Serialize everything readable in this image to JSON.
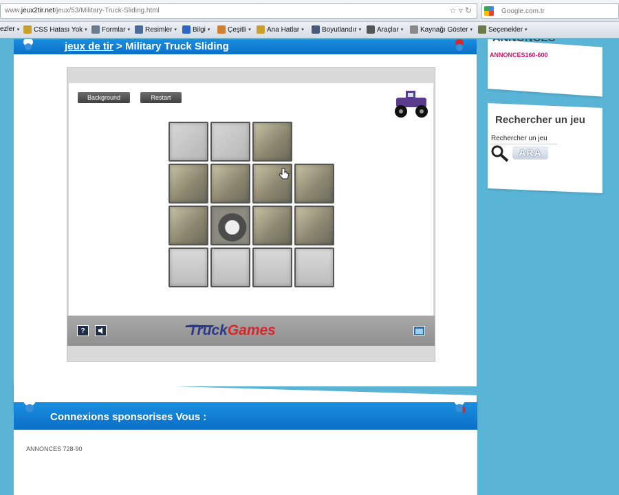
{
  "browser": {
    "url_prefix": "www.",
    "url_host": "jeux2tir.net",
    "url_path": "/jeux/53/Military-Truck-Sliding.html",
    "search_engine": "Google.com.tr",
    "toolbar": [
      {
        "label": "ezler",
        "icon": "bookmark-icon",
        "color": "#7a8ca0"
      },
      {
        "label": "CSS Hatası Yok",
        "icon": "pencil-icon",
        "color": "#c9a02a"
      },
      {
        "label": "Formlar",
        "icon": "form-icon",
        "color": "#6b7c8f"
      },
      {
        "label": "Resimler",
        "icon": "image-icon",
        "color": "#4b6c9a"
      },
      {
        "label": "Bilgi",
        "icon": "info-icon",
        "color": "#2a67c9"
      },
      {
        "label": "Çeşitli",
        "icon": "misc-icon",
        "color": "#d4802a"
      },
      {
        "label": "Ana Hatlar",
        "icon": "outline-icon",
        "color": "#c9a02a"
      },
      {
        "label": "Boyutlandır",
        "icon": "resize-icon",
        "color": "#4a5a7a"
      },
      {
        "label": "Araçlar",
        "icon": "tools-icon",
        "color": "#555"
      },
      {
        "label": "Kaynağı Göster",
        "icon": "source-icon",
        "color": "#8a8a8a"
      },
      {
        "label": "Seçenekler",
        "icon": "options-icon",
        "color": "#6a7a4a"
      }
    ]
  },
  "page": {
    "breadcrumb_link": "jeux de tir",
    "breadcrumb_sep": " > ",
    "breadcrumb_current": "Military Truck Sliding",
    "game": {
      "background_button": "Background",
      "restart_button": "Restart",
      "help_button": "?",
      "logo_part1": "Truck",
      "logo_part2": "Games"
    },
    "sponsored": {
      "title": "Connexions sponsorises Vous :",
      "ads_label": "ANNONCES 728-90"
    },
    "sidebar": {
      "annonces_title": "ANNONCES",
      "annonces_sub": "ANNONCES160-600",
      "search_title": "Rechercher un jeu",
      "search_value": "Rechercher un jeu",
      "search_button": "ARA"
    }
  },
  "puzzle": {
    "rows": 4,
    "cols": 4,
    "tiles": [
      "grey",
      "grey",
      "truck",
      "blank",
      "truck",
      "truck",
      "truck",
      "truck",
      "truck",
      "wheel",
      "truck",
      "truck",
      "ground",
      "ground",
      "ground",
      "ground"
    ]
  }
}
